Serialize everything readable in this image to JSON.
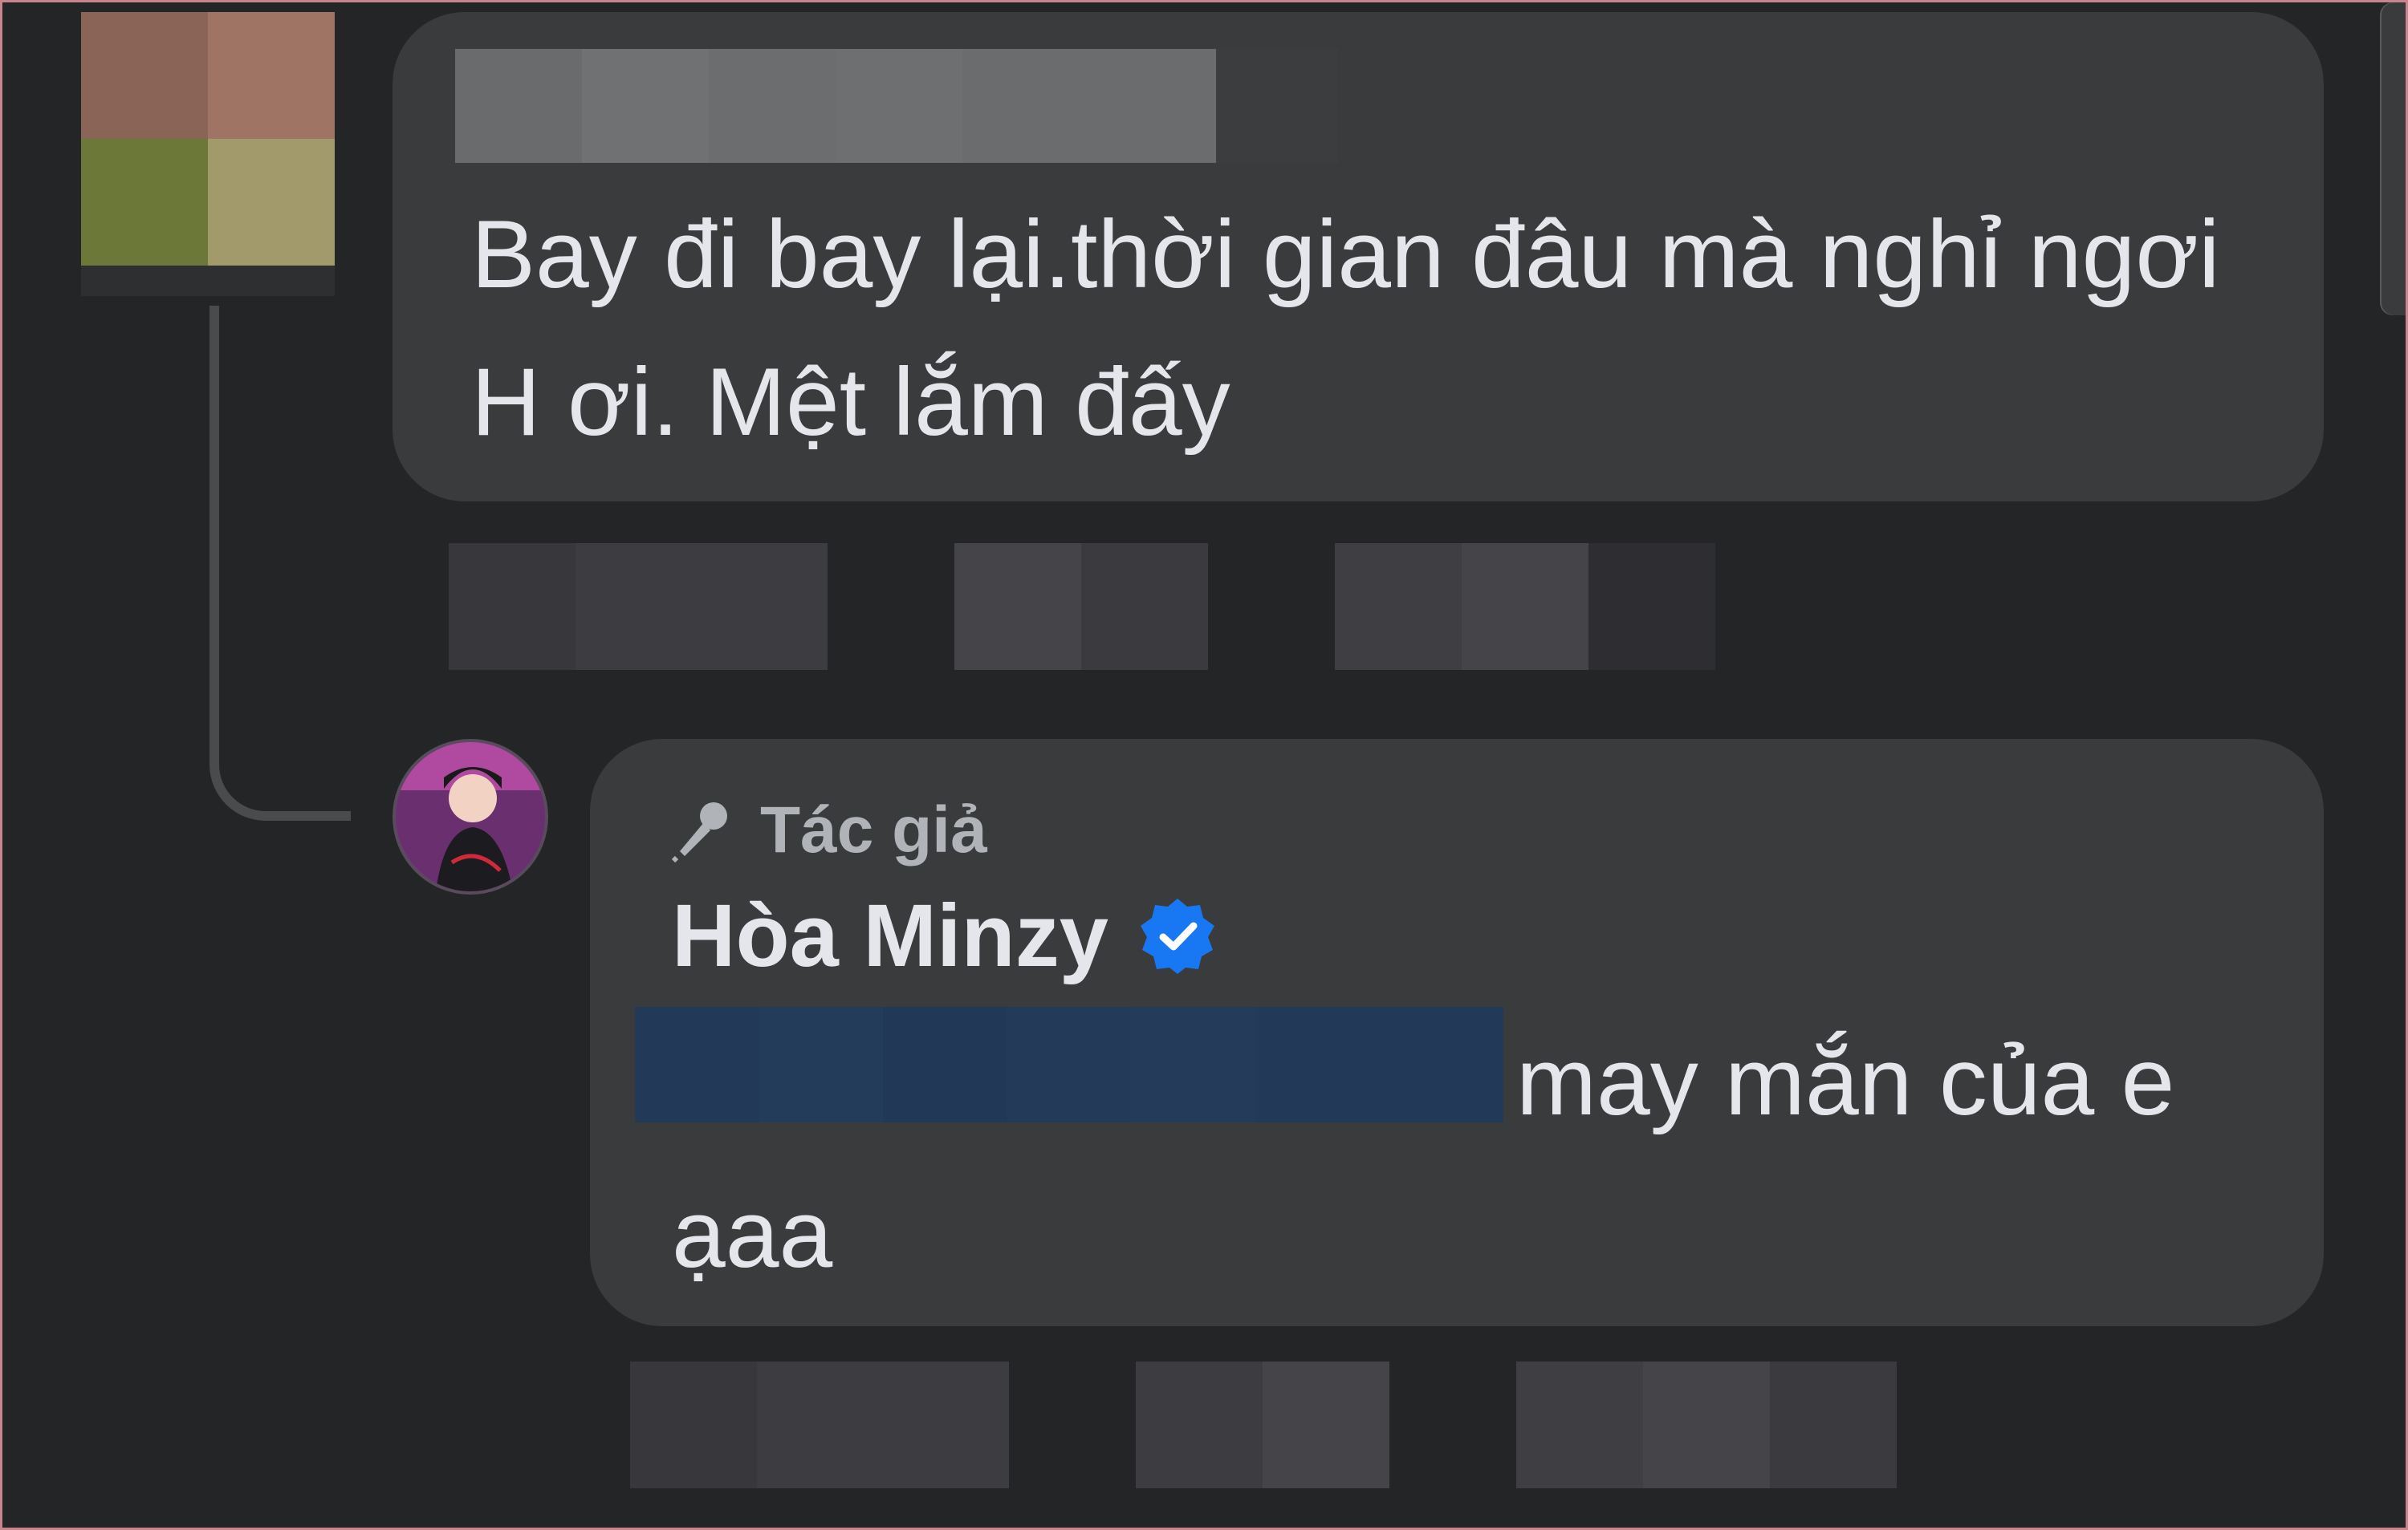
{
  "colors": {
    "background": "#242526",
    "bubble": "#3a3b3c",
    "text_primary": "#e4e6eb",
    "text_secondary": "#b0b3b8",
    "verified_blue": "#1877f2",
    "thread_line": "#4a4b4d"
  },
  "comment": {
    "avatar_icon": "blurred-avatar",
    "text": "Bay đi bay lại.thời gian đâu mà nghỉ ngơi H ơi. Mệt lắm đấy"
  },
  "reply": {
    "author_badge_icon": "microphone-icon",
    "author_badge_label": "Tác giả",
    "name": "Hòa Minzy",
    "verified_icon": "verified-badge-icon",
    "text": "may mắn của e ạaa"
  }
}
